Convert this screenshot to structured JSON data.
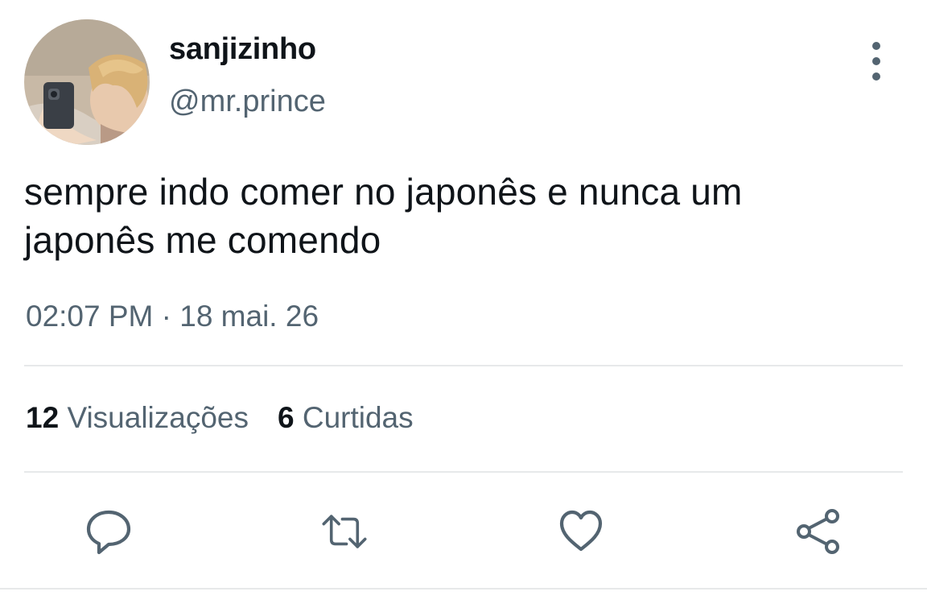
{
  "author": {
    "display_name": "sanjizinho",
    "handle": "@mr.prince",
    "avatar_icon": "profile-photo"
  },
  "tweet": {
    "text_line_1": "sempre indo comer no japonês e nunca um",
    "text_line_2": "japonês me comendo",
    "timestamp": "02:07 PM · 18 mai. 26"
  },
  "stats": {
    "views_count": "12",
    "views_label": "Visualizações",
    "likes_count": "6",
    "likes_label": "Curtidas"
  },
  "actions": [
    {
      "icon": "reply-icon"
    },
    {
      "icon": "retweet-icon"
    },
    {
      "icon": "like-icon"
    },
    {
      "icon": "share-icon"
    }
  ],
  "colors": {
    "primary_text": "#0f1419",
    "secondary_text": "#536471",
    "divider": "#e7e9ea",
    "background": "#ffffff"
  }
}
